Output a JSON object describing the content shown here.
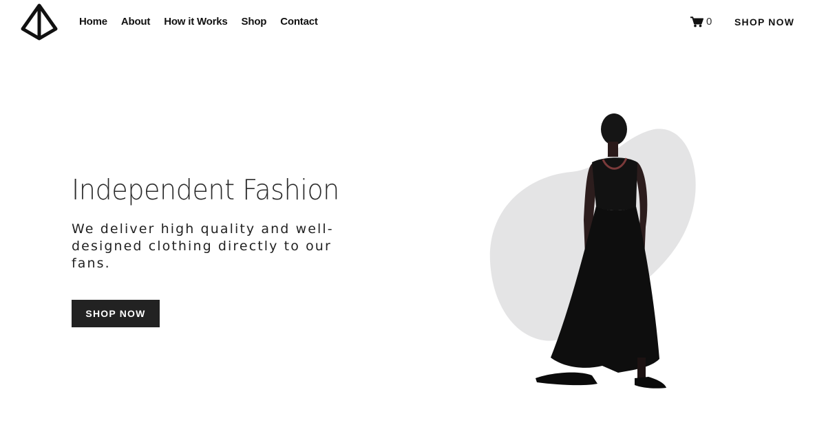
{
  "header": {
    "nav": [
      {
        "label": "Home"
      },
      {
        "label": "About"
      },
      {
        "label": "How it Works"
      },
      {
        "label": "Shop"
      },
      {
        "label": "Contact"
      }
    ],
    "cart_count": "0",
    "cta_label": "SHOP NOW"
  },
  "hero": {
    "title": "Independent Fashion",
    "subtitle": "We deliver high quality and well-designed clothing directly to our fans.",
    "button_label": "SHOP NOW"
  },
  "icons": {
    "logo": "pyramid-logo-icon",
    "cart": "shopping-cart-icon"
  },
  "colors": {
    "text": "#1b1b1b",
    "button_bg": "#222222",
    "button_text": "#ffffff",
    "backdrop": "#e4e4e5"
  }
}
